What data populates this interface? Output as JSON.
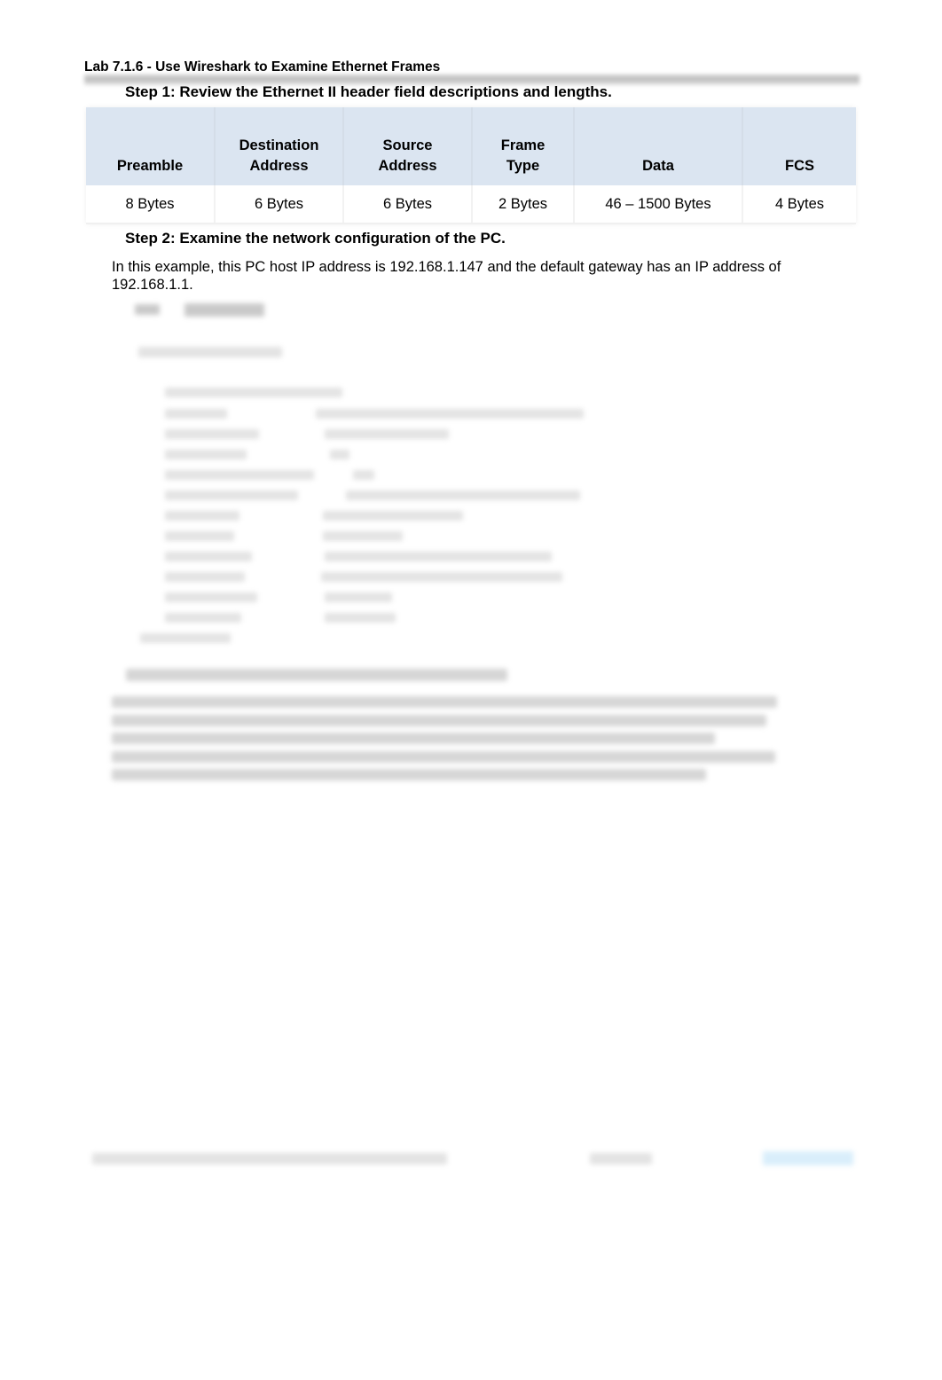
{
  "document": {
    "title": "Lab 7.1.6 - Use Wireshark to Examine Ethernet Frames"
  },
  "step1": {
    "heading": "Step 1: Review the Ethernet II header field descriptions and lengths.",
    "table": {
      "headers": [
        {
          "line1": "",
          "line2": "Preamble"
        },
        {
          "line1": "Destination",
          "line2": "Address"
        },
        {
          "line1": "Source",
          "line2": "Address"
        },
        {
          "line1": "Frame",
          "line2": "Type"
        },
        {
          "line1": "",
          "line2": "Data"
        },
        {
          "line1": "",
          "line2": "FCS"
        }
      ],
      "row": [
        "8 Bytes",
        "6 Bytes",
        "6 Bytes",
        "2 Bytes",
        "46 – 1500 Bytes",
        "4 Bytes"
      ]
    }
  },
  "step2": {
    "heading": "Step 2: Examine the network configuration of the PC.",
    "paragraph": "In this example, this PC host IP address is 192.168.1.147 and the default gateway has an IP address of 192.168.1.1."
  },
  "colors": {
    "table_header_bg": "#dbe5f1",
    "footer_accent": "#d9eefb"
  }
}
